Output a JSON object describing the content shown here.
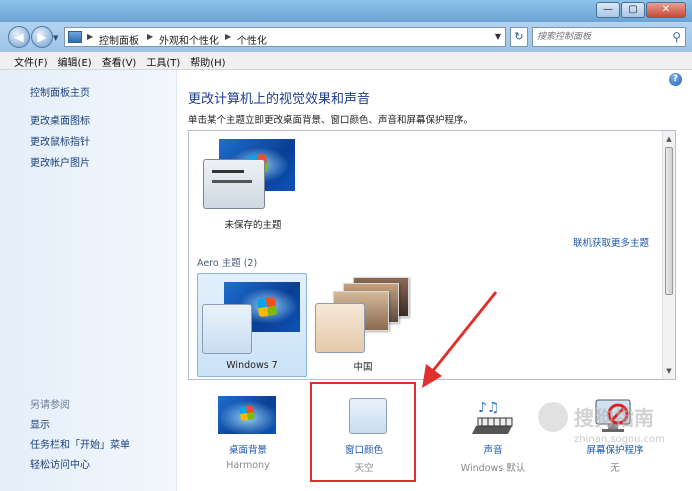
{
  "window": {
    "controls": {
      "minimize": "—",
      "maximize": "▢",
      "close": "✕"
    }
  },
  "address": {
    "back": "◀",
    "forward": "▶",
    "breadcrumbs": [
      "控制面板",
      "外观和个性化",
      "个性化"
    ],
    "search_placeholder": "搜索控制面板"
  },
  "menu": [
    "文件(F)",
    "编辑(E)",
    "查看(V)",
    "工具(T)",
    "帮助(H)"
  ],
  "sidebar": {
    "links": [
      "控制面板主页",
      "更改桌面图标",
      "更改鼠标指针",
      "更改帐户图片"
    ],
    "see_also_heading": "另请参阅",
    "see_also": [
      "显示",
      "任务栏和「开始」菜单",
      "轻松访问中心"
    ]
  },
  "main": {
    "title": "更改计算机上的视觉效果和声音",
    "description": "单击某个主题立即更改桌面背景、窗口颜色、声音和屏幕保护程序。",
    "help": "?"
  },
  "themes": {
    "unsaved": "未保存的主题",
    "online_link": "联机获取更多主题",
    "aero_section": "Aero 主题 (2)",
    "aero": [
      "Windows 7",
      "中国"
    ]
  },
  "bottom": [
    {
      "label": "桌面背景",
      "sub": "Harmony"
    },
    {
      "label": "窗口颜色",
      "sub": "天空"
    },
    {
      "label": "声音",
      "sub": "Windows 默认"
    },
    {
      "label": "屏幕保护程序",
      "sub": "无"
    }
  ],
  "watermark": {
    "text": "搜狗指南",
    "url": "zhinan.sogou.com"
  },
  "colors": {
    "accent_link": "#1a55b0",
    "title": "#1e3d8b",
    "highlight": "#e0302d"
  }
}
